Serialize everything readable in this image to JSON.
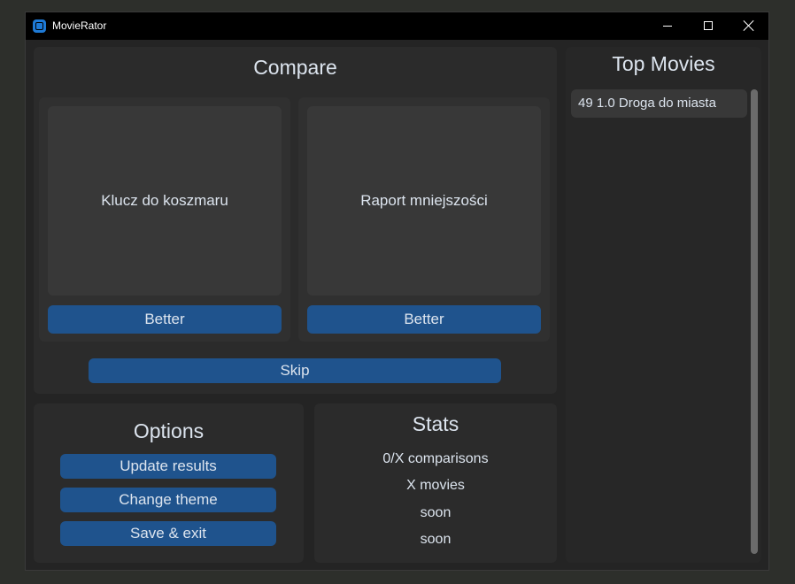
{
  "window": {
    "title": "MovieRator"
  },
  "compare": {
    "heading": "Compare",
    "left": {
      "title": "Klucz do koszmaru",
      "button": "Better"
    },
    "right": {
      "title": "Raport mniejszości",
      "button": "Better"
    },
    "skip": "Skip"
  },
  "options": {
    "heading": "Options",
    "buttons": [
      "Update results",
      "Change theme",
      "Save & exit"
    ]
  },
  "stats": {
    "heading": "Stats",
    "lines": [
      "0/X comparisons",
      "X movies",
      "soon",
      "soon"
    ]
  },
  "top": {
    "heading": "Top Movies",
    "items": [
      "49 1.0 Droga do miasta"
    ]
  },
  "colors": {
    "accent": "#1f538d",
    "panel": "#2b2b2b",
    "background": "#242424"
  }
}
